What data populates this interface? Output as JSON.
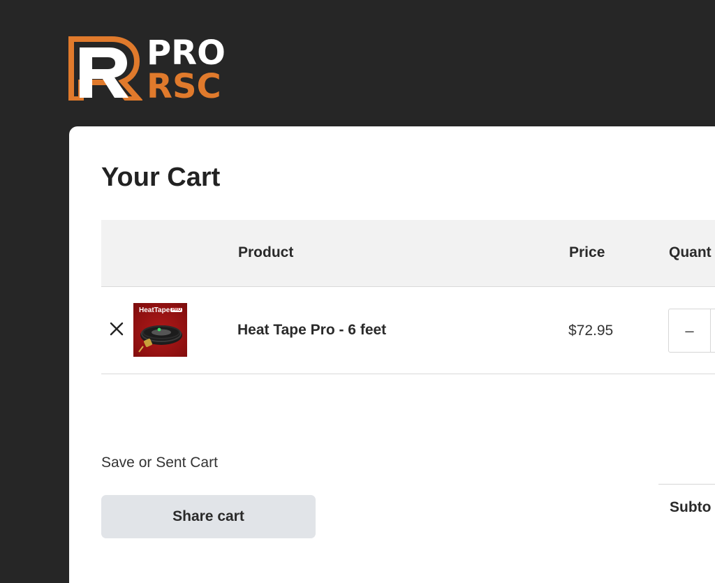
{
  "brand": {
    "line1": "PRO",
    "line2": "RSC",
    "mark_letter": "R",
    "colors": {
      "accent": "#e07a2c",
      "white": "#ffffff",
      "background": "#262626"
    }
  },
  "cart": {
    "title": "Your Cart",
    "columns": {
      "product": "Product",
      "price": "Price",
      "quantity": "Quant"
    },
    "items": [
      {
        "name": "Heat Tape Pro - 6 feet",
        "price": "$72.95",
        "thumbnail_brand": "HeatTape",
        "thumbnail_badge": "PRO",
        "remove_icon": "close-icon",
        "decrement_label": "–"
      }
    ],
    "save_label": "Save or Sent Cart",
    "share_button": "Share cart",
    "subtotal_label": "Subto"
  }
}
